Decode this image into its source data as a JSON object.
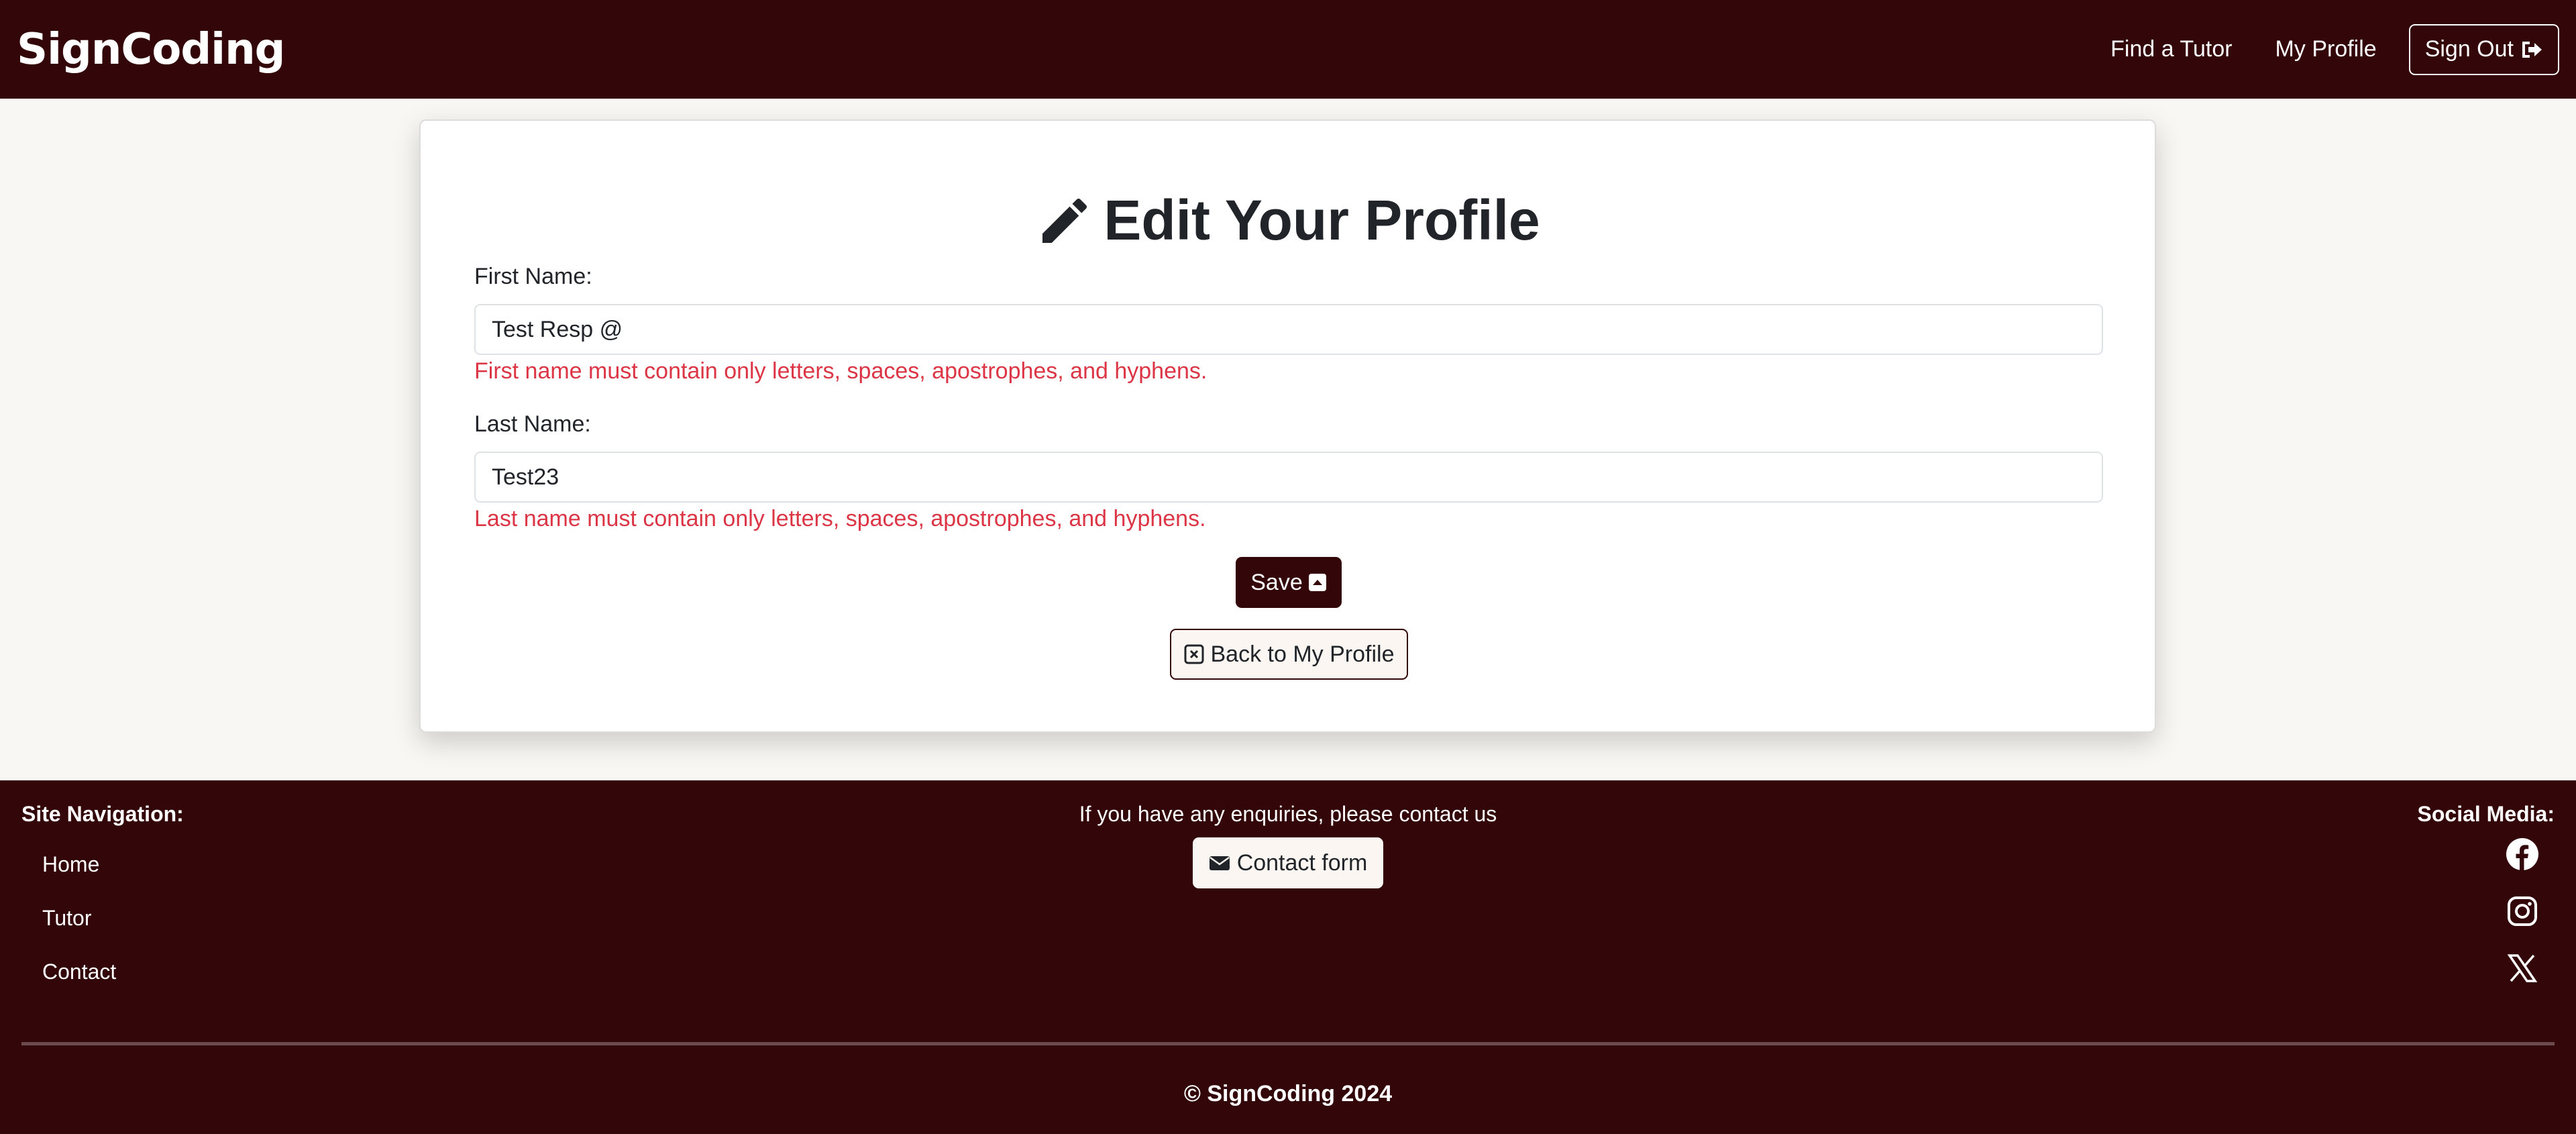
{
  "header": {
    "brand": "SignCoding",
    "nav": [
      {
        "label": "Find a Tutor"
      },
      {
        "label": "My Profile"
      }
    ],
    "signout_label": "Sign Out"
  },
  "form": {
    "title": "Edit Your Profile",
    "first_name": {
      "label": "First Name:",
      "value": "Test Resp @",
      "error": "First name must contain only letters, spaces, apostrophes, and hyphens."
    },
    "last_name": {
      "label": "Last Name:",
      "value": "Test23",
      "error": "Last name must contain only letters, spaces, apostrophes, and hyphens."
    },
    "save_label": "Save",
    "back_label": "Back to My Profile"
  },
  "footer": {
    "nav_heading": "Site Navigation:",
    "nav_links": [
      {
        "label": "Home"
      },
      {
        "label": "Tutor"
      },
      {
        "label": "Contact"
      }
    ],
    "enquiry_text": "If you have any enquiries, please contact us",
    "contact_label": "Contact form",
    "social_heading": "Social Media:",
    "social_icons": [
      "facebook-icon",
      "instagram-icon",
      "x-icon"
    ],
    "copyright": "© SignCoding 2024"
  },
  "colors": {
    "brand": "#33060a",
    "background": "#f9f7f3",
    "error": "#dc3545",
    "button_light": "#fbf6f1"
  }
}
